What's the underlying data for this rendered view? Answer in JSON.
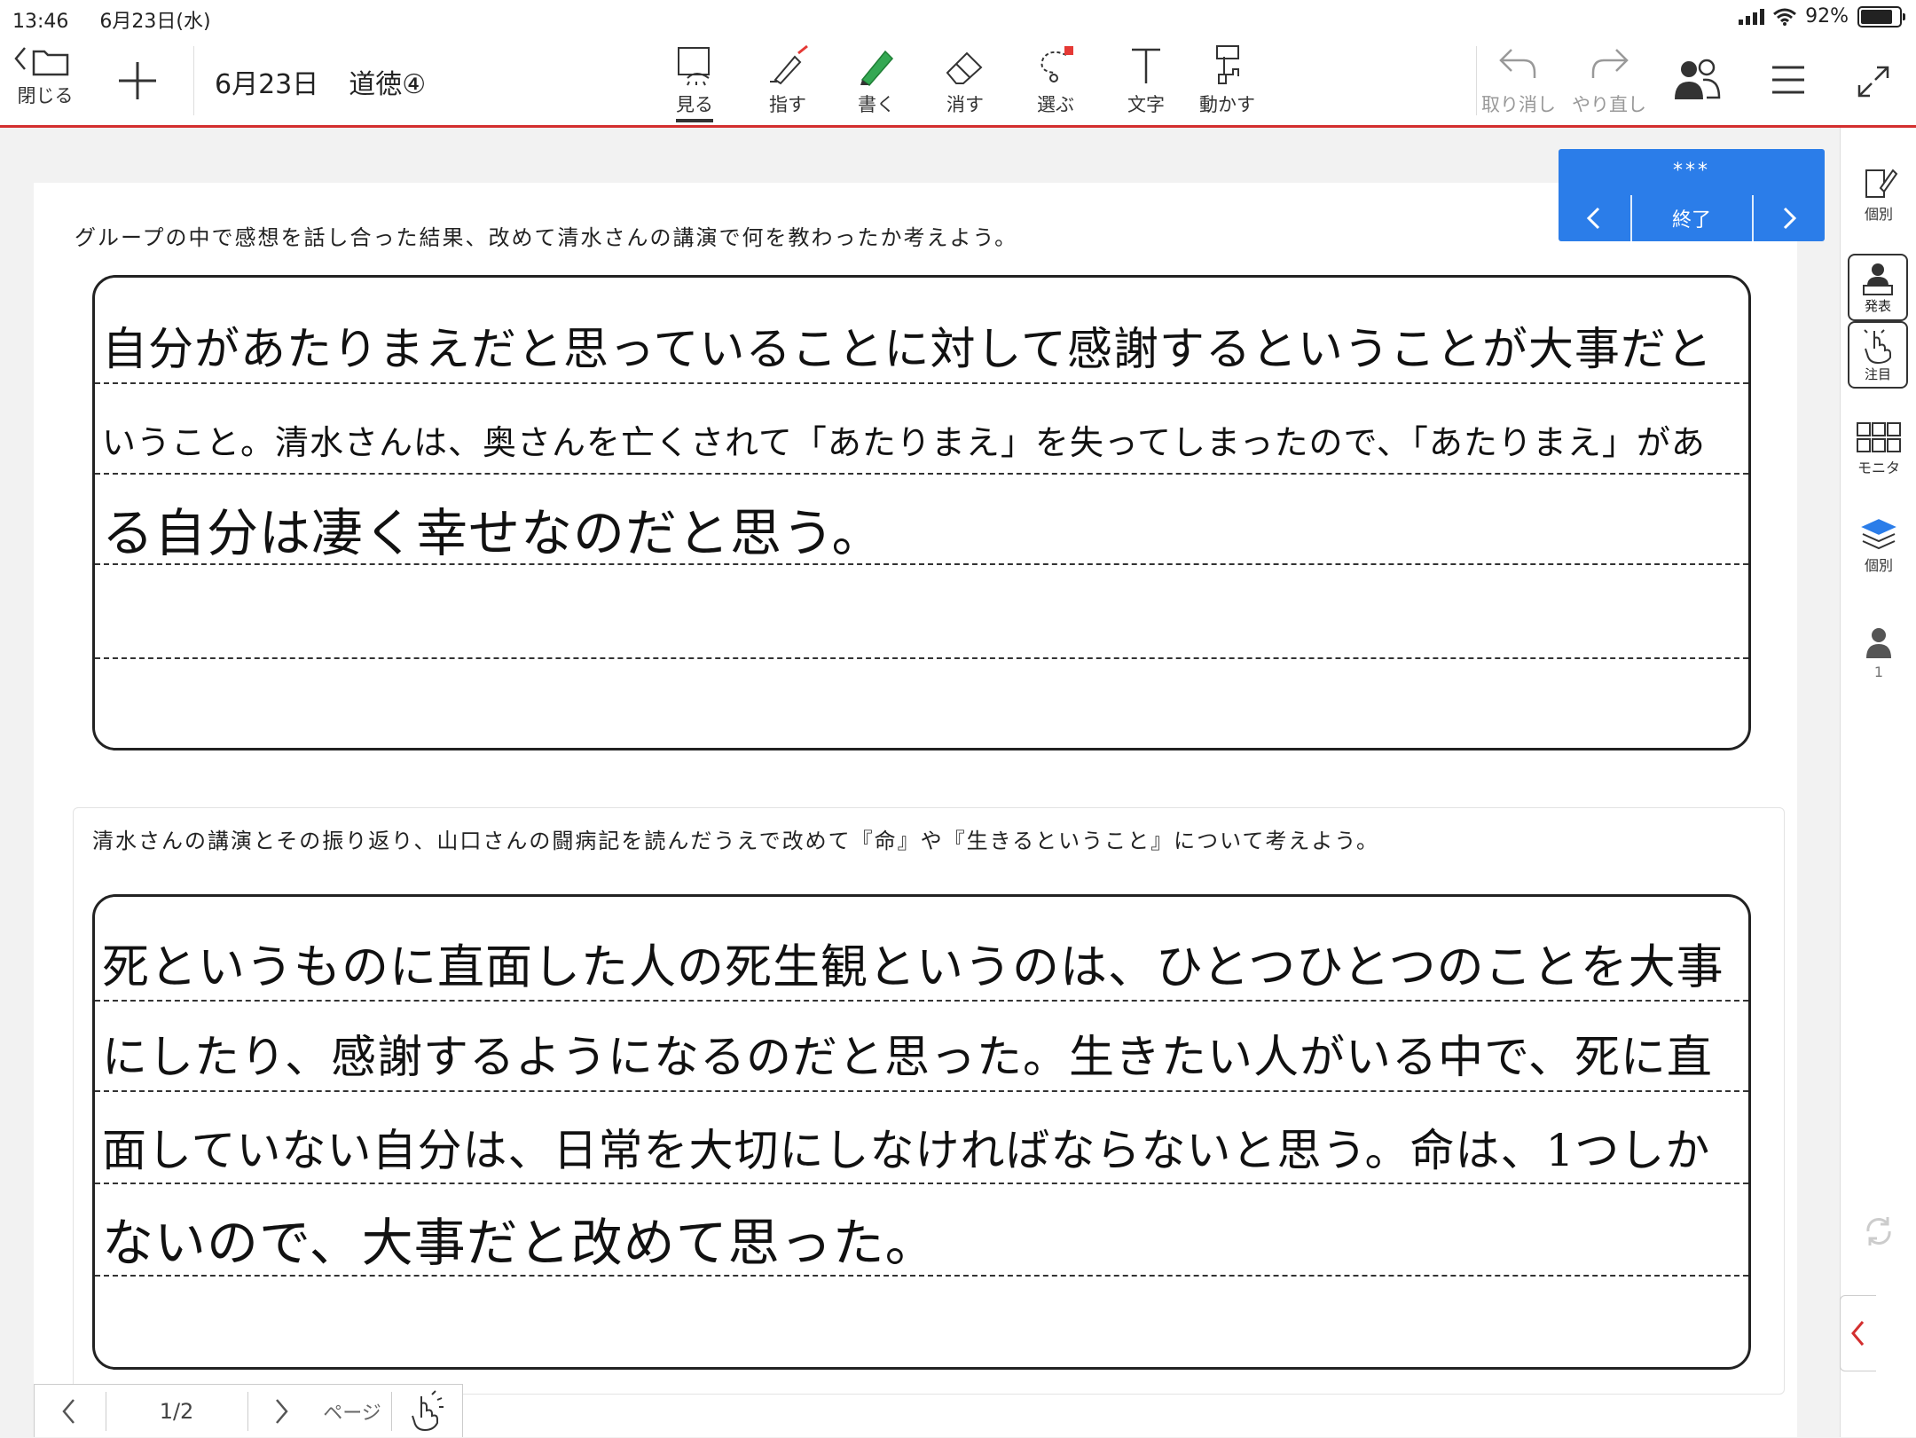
{
  "status_bar": {
    "time": "13:46",
    "date": "6月23日(水)",
    "battery": "92%",
    "battery_level": 0.92
  },
  "toolbar": {
    "close_label": "閉じる",
    "title_date": "6月23日",
    "title_subject": "道徳④",
    "tools": [
      {
        "label": "見る",
        "icon": "eye-view-icon"
      },
      {
        "label": "指す",
        "icon": "laser-pointer-icon"
      },
      {
        "label": "書く",
        "icon": "pen-icon"
      },
      {
        "label": "消す",
        "icon": "eraser-icon"
      },
      {
        "label": "選ぶ",
        "icon": "lasso-select-icon"
      },
      {
        "label": "文字",
        "icon": "text-icon"
      },
      {
        "label": "動かす",
        "icon": "move-hand-icon"
      }
    ],
    "undo_label": "取り消し",
    "redo_label": "やり直し"
  },
  "presenter": {
    "name": "***",
    "end_label": "終了"
  },
  "sidebar": {
    "individual_label": "個別",
    "present_label": "発表",
    "focus_label": "注目",
    "monitor_label": "モニタ",
    "layers_label": "個別",
    "user_count": "1"
  },
  "worksheet": {
    "question1": "グループの中で感想を話し合った結果、改めて清水さんの講演で何を教わったか考えよう。",
    "answer1": [
      "自分があたりまえだと思っていることに対して感謝するということが大事だと",
      "いうこと。清水さんは、奥さんを亡くされて「あたりまえ」を失ってしまったので、「あたりまえ」があ",
      "る自分は凄く幸せなのだと思う。"
    ],
    "question2": "清水さんの講演とその振り返り、山口さんの闘病記を読んだうえで改めて『命』や『生きるということ』について考えよう。",
    "answer2": [
      "死というものに直面した人の死生観というのは、ひとつひとつのことを大事",
      "にしたり、感謝するようになるのだと思った。生きたい人がいる中で、死に直",
      "面していない自分は、日常を大切にしなければならないと思う。命は、1つしか",
      "ないので、大事だと改めて思った。"
    ]
  },
  "pager": {
    "current": "1/2",
    "label": "ページ"
  }
}
